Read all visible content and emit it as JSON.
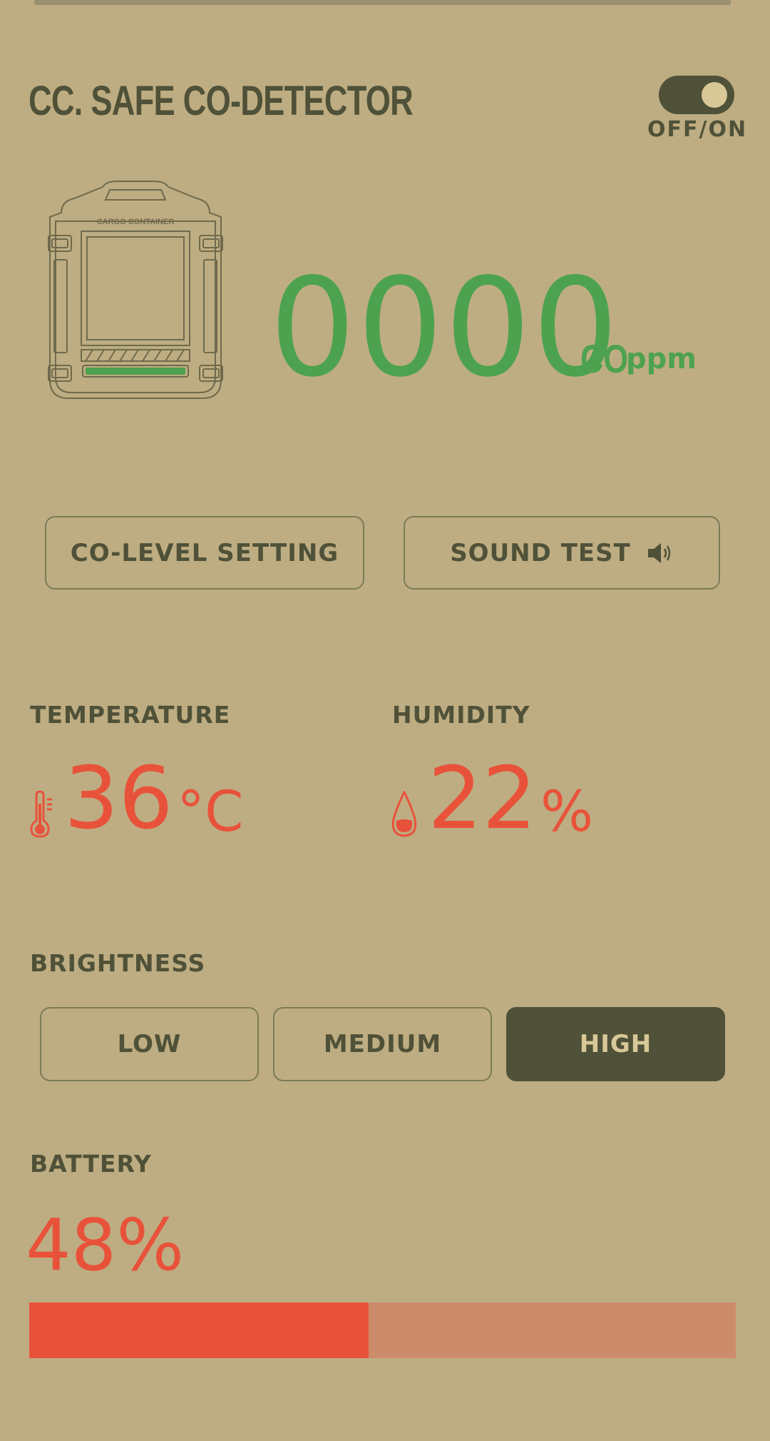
{
  "header": {
    "title": "CC. SAFE CO-DETECTOR",
    "power_toggle_label": "OFF/ON",
    "power_on": true
  },
  "device": {
    "image_label": "CARGO CONTAINER"
  },
  "co": {
    "value": "0000",
    "unit_gas": "CO",
    "unit": "ppm",
    "color": "#4da24f"
  },
  "actions": {
    "co_level_setting": "CO-LEVEL SETTING",
    "sound_test": "SOUND TEST"
  },
  "temperature": {
    "label": "TEMPERATURE",
    "value": "36",
    "unit": "°C"
  },
  "humidity": {
    "label": "HUMIDITY",
    "value": "22",
    "unit": "%"
  },
  "brightness": {
    "label": "BRIGHTNESS",
    "options": [
      "LOW",
      "MEDIUM",
      "HIGH"
    ],
    "selected": "HIGH"
  },
  "battery": {
    "label": "BATTERY",
    "value_text": "48%",
    "level": 0.48
  },
  "colors": {
    "background": "#bead82",
    "primary_dark": "#4f5138",
    "accent_red": "#e9523a",
    "accent_green": "#4da24f",
    "battery_track": "#cc8c6b"
  }
}
